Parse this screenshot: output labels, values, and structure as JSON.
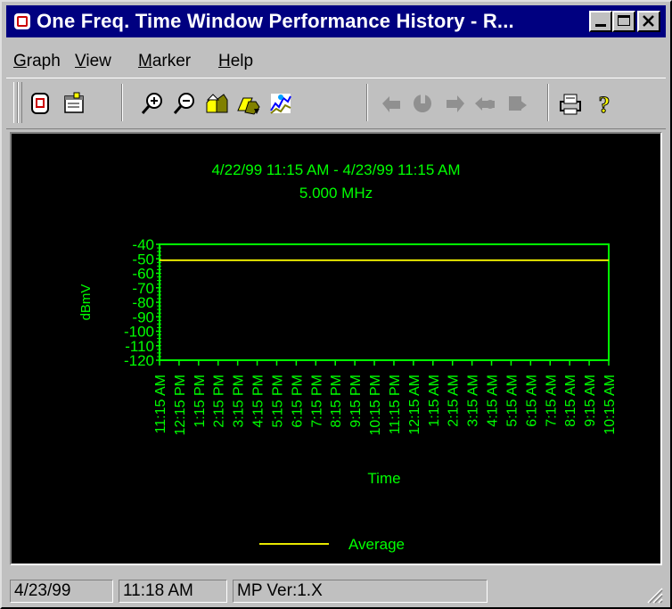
{
  "window": {
    "title": "One Freq. Time Window Performance History - R..."
  },
  "menu": [
    {
      "label": "Graph",
      "mnemonic": "G",
      "rest": "raph"
    },
    {
      "label": "View",
      "mnemonic": "V",
      "rest": "iew"
    },
    {
      "label": "Marker",
      "mnemonic": "M",
      "rest": "arker"
    },
    {
      "label": "Help",
      "mnemonic": "H",
      "rest": "elp"
    }
  ],
  "toolbar": {
    "icons": [
      "database-icon",
      "properties-icon",
      "zoom-in-icon",
      "zoom-out-icon",
      "home-icon",
      "forward-icon",
      "chart-icon",
      "prev-marker-icon",
      "marker-icon",
      "next-marker-icon",
      "marker-2-icon",
      "marker-3-icon",
      "print-icon",
      "help-icon"
    ],
    "disabled": [
      7,
      8,
      9,
      10,
      11
    ]
  },
  "chart_data": {
    "type": "line",
    "title": "4/22/99 11:15 AM - 4/23/99 11:15 AM",
    "subtitle": "5.000 MHz",
    "xlabel": "Time",
    "ylabel": "dBmV",
    "ylim": [
      -120,
      -40
    ],
    "y_ticks": [
      -40,
      -50,
      -60,
      -70,
      -80,
      -90,
      -100,
      -110,
      -120
    ],
    "categories": [
      "11:15 AM",
      "12:15 PM",
      "1:15 PM",
      "2:15 PM",
      "3:15 PM",
      "4:15 PM",
      "5:15 PM",
      "6:15 PM",
      "7:15 PM",
      "8:15 PM",
      "9:15 PM",
      "10:15 PM",
      "11:15 PM",
      "12:15 AM",
      "1:15 AM",
      "2:15 AM",
      "3:15 AM",
      "4:15 AM",
      "5:15 AM",
      "6:15 AM",
      "7:15 AM",
      "8:15 AM",
      "9:15 AM",
      "10:15 AM"
    ],
    "series": [
      {
        "name": "Average",
        "color": "#e8e800",
        "values": [
          -51,
          -51,
          -51,
          -51,
          -51,
          -51,
          -51,
          -51,
          -51,
          -51,
          -51,
          -51,
          -51,
          -51,
          -51,
          -51,
          -51,
          -51,
          -51,
          -51,
          -51,
          -51,
          -51,
          -51
        ]
      }
    ],
    "colors": {
      "axis": "#00ff00",
      "background": "#000000"
    },
    "legend": "bottom"
  },
  "status": {
    "date": "4/23/99",
    "time": "11:18 AM",
    "version": "MP Ver:1.X"
  }
}
